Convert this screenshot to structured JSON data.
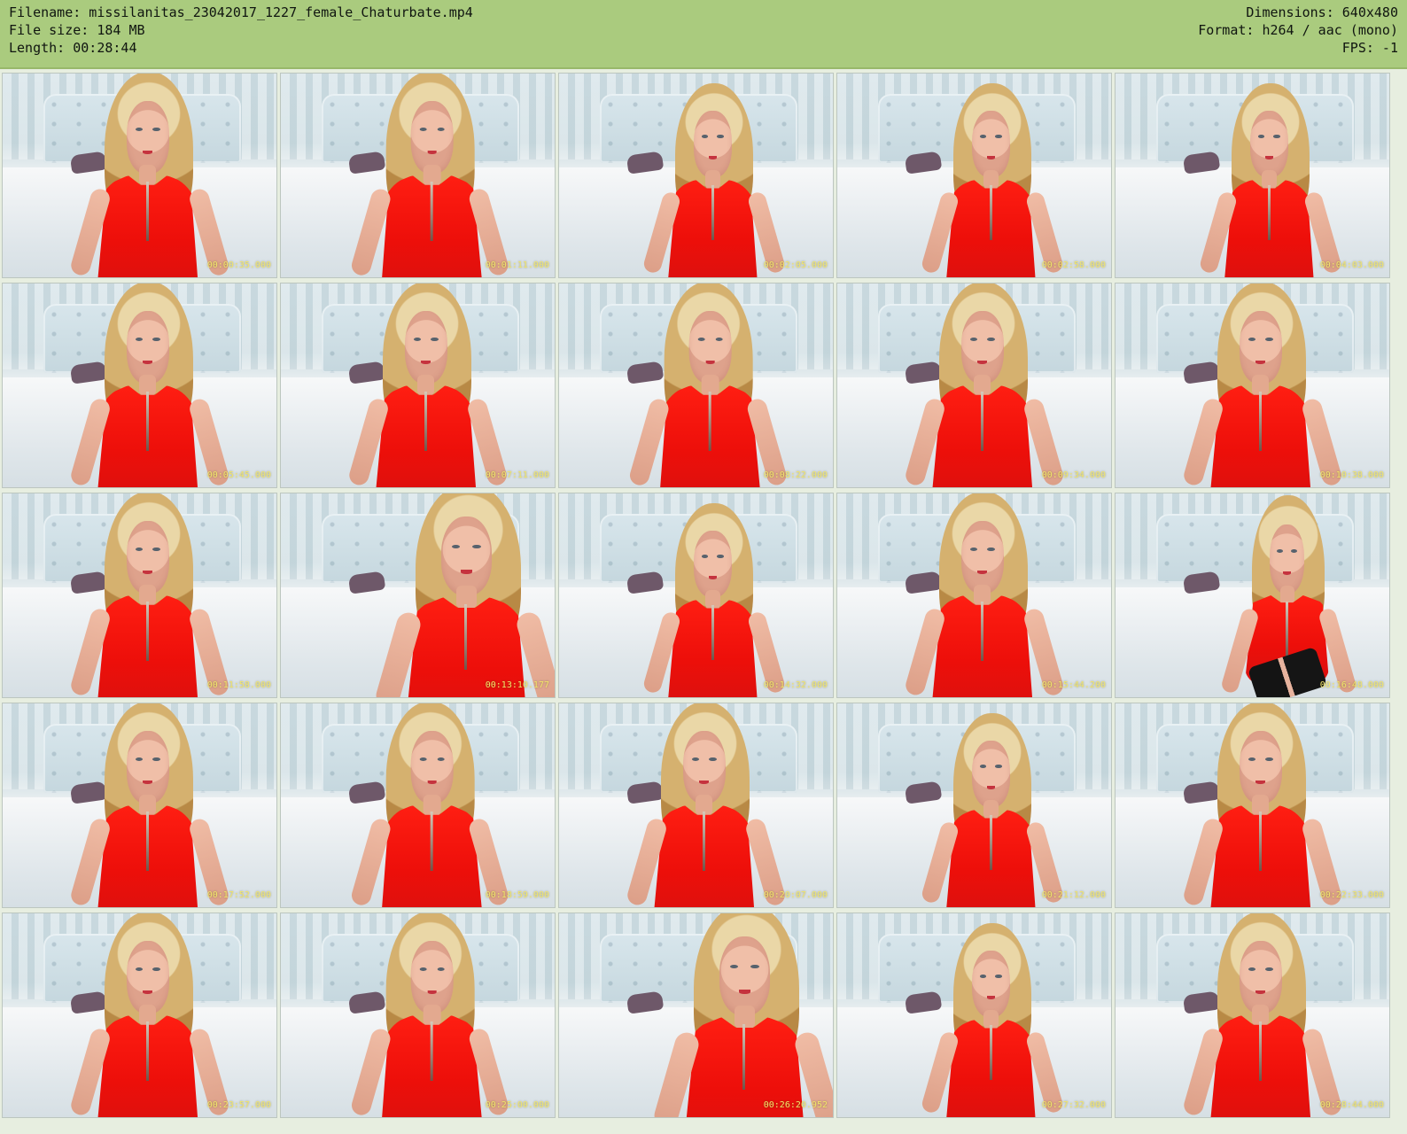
{
  "header": {
    "left": [
      "Filename: missilanitas_23042017_1227_female_Chaturbate.mp4",
      "File size: 184 MB",
      "Length: 00:28:44"
    ],
    "right": [
      "Dimensions: 640x480",
      "Format: h264 / aac (mono)",
      "FPS: -1"
    ]
  },
  "thumbnails": [
    {
      "timestamp": "00:00:35.000"
    },
    {
      "timestamp": "00:01:11.000"
    },
    {
      "timestamp": "00:02:05.000"
    },
    {
      "timestamp": "00:02:58.000"
    },
    {
      "timestamp": "00:04:03.000"
    },
    {
      "timestamp": "00:05:45.000"
    },
    {
      "timestamp": "00:07:11.000"
    },
    {
      "timestamp": "00:08:22.000"
    },
    {
      "timestamp": "00:09:34.000"
    },
    {
      "timestamp": "00:10:38.000"
    },
    {
      "timestamp": "00:11:58.000"
    },
    {
      "timestamp": "00:13:10.177"
    },
    {
      "timestamp": "00:14:32.000"
    },
    {
      "timestamp": "00:15:44.200"
    },
    {
      "timestamp": "00:16:48.000"
    },
    {
      "timestamp": "00:17:52.000"
    },
    {
      "timestamp": "00:18:59.000"
    },
    {
      "timestamp": "00:20:07.000"
    },
    {
      "timestamp": "00:21:12.000"
    },
    {
      "timestamp": "00:22:33.000"
    },
    {
      "timestamp": "00:23:57.000"
    },
    {
      "timestamp": "00:25:00.000"
    },
    {
      "timestamp": "00:26:20.952"
    },
    {
      "timestamp": "00:27:32.000"
    },
    {
      "timestamp": "00:28:44.000"
    }
  ]
}
